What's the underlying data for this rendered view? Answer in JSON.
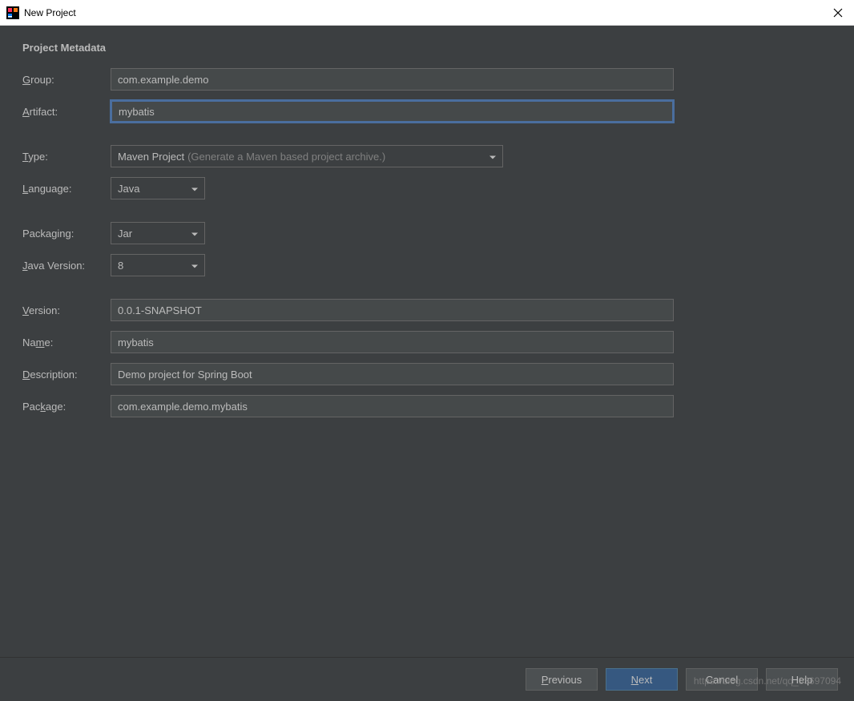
{
  "window": {
    "title": "New Project"
  },
  "section": {
    "title": "Project Metadata"
  },
  "labels": {
    "group": "Group:",
    "artifact": "Artifact:",
    "type": "Type:",
    "language": "Language:",
    "packaging": "Packaging:",
    "java_version": "Java Version:",
    "version": "Version:",
    "name": "Name:",
    "description": "Description:",
    "package": "Package:"
  },
  "values": {
    "group": "com.example.demo",
    "artifact": "mybatis",
    "type": "Maven Project",
    "type_hint": "(Generate a Maven based project archive.)",
    "language": "Java",
    "packaging": "Jar",
    "java_version": "8",
    "version": "0.0.1-SNAPSHOT",
    "name": "mybatis",
    "description": "Demo project for Spring Boot",
    "package": "com.example.demo.mybatis"
  },
  "buttons": {
    "previous": "Previous",
    "next": "Next",
    "cancel": "Cancel",
    "help": "Help"
  },
  "watermark": "https://blog.csdn.net/qq_33697094"
}
